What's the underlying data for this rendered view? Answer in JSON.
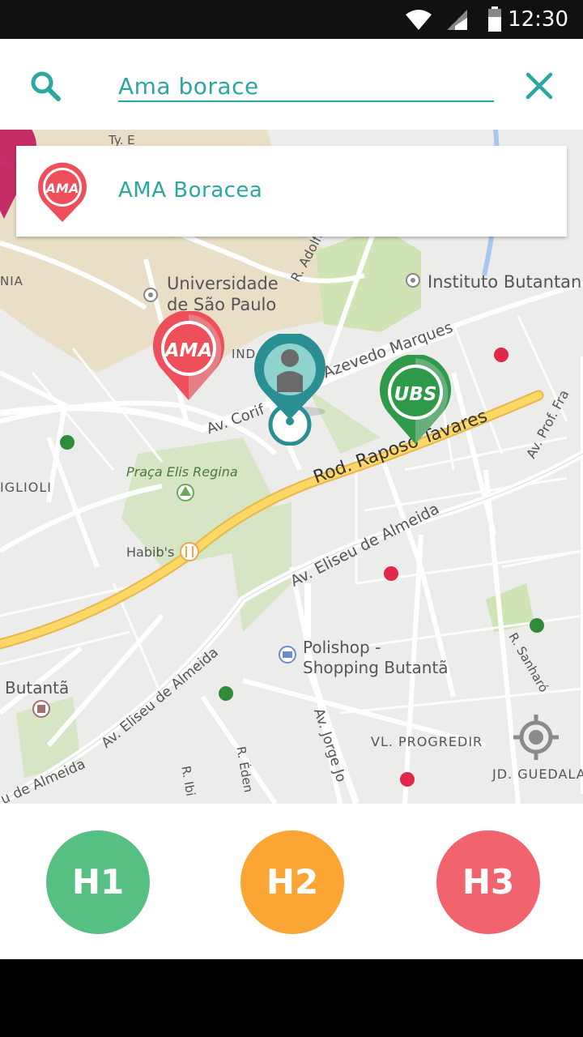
{
  "status_bar": {
    "time": "12:30"
  },
  "search": {
    "query": "Ama borace"
  },
  "suggestions": [
    {
      "badge_text": "AMA",
      "name": "AMA Boracea"
    }
  ],
  "map": {
    "labels": {
      "universidade_1": "Universidade",
      "universidade_2": "de São Paulo",
      "instituto": "Instituto Butantan",
      "adolfo_lutz": "R. Adolfo Lutz",
      "azevedo": "Azevedo Marques",
      "corifeu": "Av. Corif",
      "raposo": "Rod. Raposo Tavares",
      "praca": "Praça Elis Regina",
      "habibs": "Habib's",
      "eliseu_1": "Av. Eliseu de Almeida",
      "eliseu_2": "Av. Eliseu de Almeida",
      "eliseu_3": "u de Almeida",
      "polishop_1": "Polishop -",
      "polishop_2": "Shopping Butantã",
      "butanta": "Butantã",
      "jorge": "Av. Jorge Jo",
      "progredir": "VL. PROGREDIR",
      "guedala": "JD. GUEDALA",
      "prof": "Av. Prof. Fra",
      "sanharo": "R. Sanharó",
      "eden": "R. Éden",
      "ibi": "R. Ibi",
      "nia": "NIA",
      "iglioli": "IGLIOLI",
      "inda": "INDA",
      "ty": "Ty. E"
    },
    "markers": [
      {
        "badge": "AMA",
        "color": "#ef4f5a"
      },
      {
        "badge": "UBS",
        "color": "#2e9a4a"
      }
    ]
  },
  "filters": [
    {
      "label": "H1",
      "color": "#56c083"
    },
    {
      "label": "H2",
      "color": "#fba634"
    },
    {
      "label": "H3",
      "color": "#f1646e"
    }
  ]
}
